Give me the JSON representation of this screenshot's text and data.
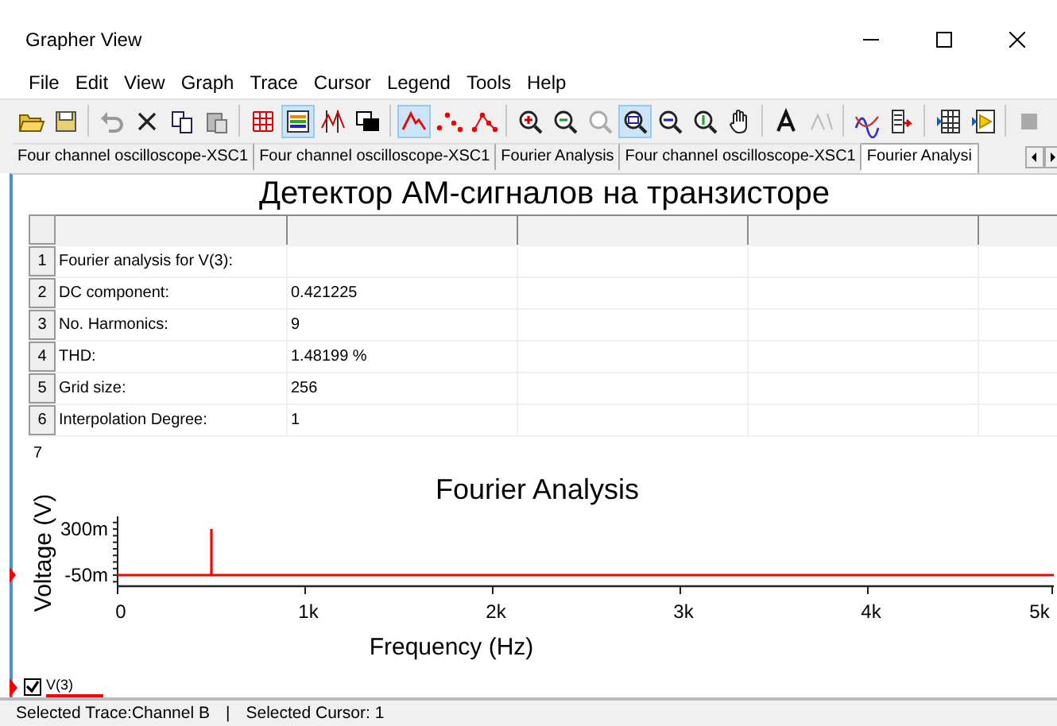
{
  "window": {
    "title": "Grapher View"
  },
  "menu": [
    "File",
    "Edit",
    "View",
    "Graph",
    "Trace",
    "Cursor",
    "Legend",
    "Tools",
    "Help"
  ],
  "toolbar": [
    {
      "kind": "open",
      "pressed": false
    },
    {
      "kind": "save",
      "pressed": false
    },
    {
      "kind": "sep"
    },
    {
      "kind": "undo",
      "pressed": false
    },
    {
      "kind": "delete",
      "pressed": false
    },
    {
      "kind": "copy",
      "pressed": false
    },
    {
      "kind": "paste",
      "pressed": false
    },
    {
      "kind": "sep"
    },
    {
      "kind": "grid",
      "pressed": false
    },
    {
      "kind": "legend",
      "pressed": true
    },
    {
      "kind": "cursors",
      "pressed": false
    },
    {
      "kind": "overlay",
      "pressed": false
    },
    {
      "kind": "sep"
    },
    {
      "kind": "lines",
      "pressed": true
    },
    {
      "kind": "points",
      "pressed": false
    },
    {
      "kind": "linepoints",
      "pressed": false
    },
    {
      "kind": "sep"
    },
    {
      "kind": "zoomin",
      "pressed": false
    },
    {
      "kind": "zoomout",
      "pressed": false
    },
    {
      "kind": "zoomfull",
      "pressed": false
    },
    {
      "kind": "zoomarea",
      "pressed": true
    },
    {
      "kind": "zoomx",
      "pressed": false
    },
    {
      "kind": "zoomy",
      "pressed": false
    },
    {
      "kind": "pan",
      "pressed": false
    },
    {
      "kind": "sep"
    },
    {
      "kind": "text",
      "pressed": false
    },
    {
      "kind": "label",
      "pressed": false
    },
    {
      "kind": "sep"
    },
    {
      "kind": "traces",
      "pressed": false
    },
    {
      "kind": "export",
      "pressed": false
    },
    {
      "kind": "sep"
    },
    {
      "kind": "sheet",
      "pressed": false
    },
    {
      "kind": "sheetplay",
      "pressed": false
    },
    {
      "kind": "sep"
    },
    {
      "kind": "stop",
      "pressed": false
    }
  ],
  "tabs": [
    {
      "label": "Four channel oscilloscope-XSC1",
      "selected": false
    },
    {
      "label": "Four channel oscilloscope-XSC1",
      "selected": false
    },
    {
      "label": "Fourier Analysis",
      "selected": false
    },
    {
      "label": "Four channel oscilloscope-XSC1",
      "selected": false
    },
    {
      "label": "Fourier Analysi",
      "selected": true
    }
  ],
  "page_title": "Детектор АМ-сигналов на транзисторе",
  "table": {
    "rows": [
      {
        "number": "1",
        "label": "Fourier analysis for V(3):"
      },
      {
        "number": "2",
        "label": "DC component:",
        "value": "0.421225"
      },
      {
        "number": "3",
        "label": "No. Harmonics:",
        "value": "9"
      },
      {
        "number": "4",
        "label": "THD:",
        "value": "1.48199 %"
      },
      {
        "number": "5",
        "label": "Grid size:",
        "value": "256"
      },
      {
        "number": "6",
        "label": "Interpolation Degree:",
        "value": "1"
      },
      {
        "number": "7"
      }
    ]
  },
  "graph": {
    "chart_data": {
      "type": "line",
      "title": "Fourier Analysis",
      "xlabel": "Frequency (Hz)",
      "ylabel": "Voltage (V)",
      "x": [
        0,
        500,
        500,
        500,
        5000
      ],
      "series": [
        {
          "name": "V(3)",
          "color": "#ff0000",
          "values": [
            -50,
            -50,
            300,
            -50,
            -50
          ]
        }
      ],
      "xlim": [
        0,
        5000
      ],
      "ylim": [
        -134,
        385
      ],
      "xticks": [
        {
          "value": 0,
          "label": "0"
        },
        {
          "value": 1000,
          "label": "1k"
        },
        {
          "value": 2000,
          "label": "2k"
        },
        {
          "value": 3000,
          "label": "3k"
        },
        {
          "value": 4000,
          "label": "4k"
        },
        {
          "value": 5000,
          "label": "5k"
        }
      ],
      "yticks": [
        {
          "value": 300,
          "label": "300m"
        },
        {
          "value": -50,
          "label": "-50m"
        }
      ]
    },
    "legend": [
      {
        "checked": true
      }
    ]
  },
  "status_bar": [
    "Selected Trace:Channel B",
    "|",
    "Selected Cursor: 1"
  ]
}
